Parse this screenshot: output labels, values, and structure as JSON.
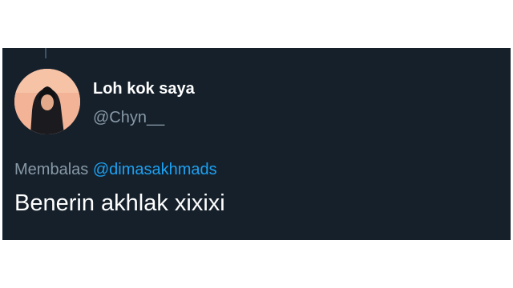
{
  "tweet": {
    "display_name": "Loh kok saya",
    "handle": "@Chyn__",
    "reply_prefix": "Membalas",
    "reply_mention": "@dimasakhmads",
    "text": "Benerin akhlak xixixi"
  },
  "colors": {
    "background": "#15202b",
    "name": "#ffffff",
    "secondary_text": "#8899a6",
    "mention": "#1da1f2",
    "thread_line": "#3d5466"
  },
  "icons": {
    "avatar": "profile-photo-avatar"
  }
}
